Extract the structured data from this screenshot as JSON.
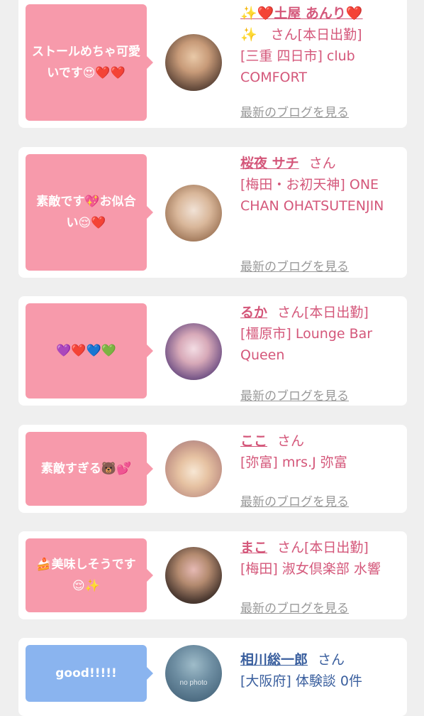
{
  "cards": [
    {
      "comment": "ストールめちゃ可愛いです😍❤️❤️",
      "name": "✨❤️土屋 あんり❤️",
      "san": "✨　さん[本日出勤]",
      "shop": "[三重 四日市] club COMFORT",
      "blog": "最新のブログを見る"
    },
    {
      "comment": "素敵です💖お似合い😌❤️",
      "name": "桜夜 サチ",
      "san": "さん",
      "shop": "[梅田・お初天神] ONE CHAN OHATSUTENJIN",
      "blog": "最新のブログを見る"
    },
    {
      "comment": "💜❤️💙💚",
      "name": "るか",
      "san": "さん[本日出勤]",
      "shop": "[橿原市] Lounge Bar Queen",
      "blog": "最新のブログを見る"
    },
    {
      "comment": "素敵すぎる🐻💕",
      "name": "ここ",
      "san": "さん",
      "shop": "[弥富] mrs.J 弥富",
      "blog": "最新のブログを見る"
    },
    {
      "comment": "🍰美味しそうです😌✨",
      "name": "まこ",
      "san": "さん[本日出勤]",
      "shop": "[梅田] 淑女倶楽部 水響",
      "blog": "最新のブログを見る"
    },
    {
      "comment": "good!!!!!",
      "name": "相川総一郎",
      "san": "さん",
      "shop": "[大阪府] 体験談 0件",
      "avatar_text": "no photo",
      "blog": ""
    }
  ],
  "colors": {
    "bubble_pink": "#f79aab",
    "bubble_blue": "#8ab4ef",
    "text_pink": "#d4577a",
    "text_blue": "#3a5f9e",
    "link_gray": "#999999"
  }
}
